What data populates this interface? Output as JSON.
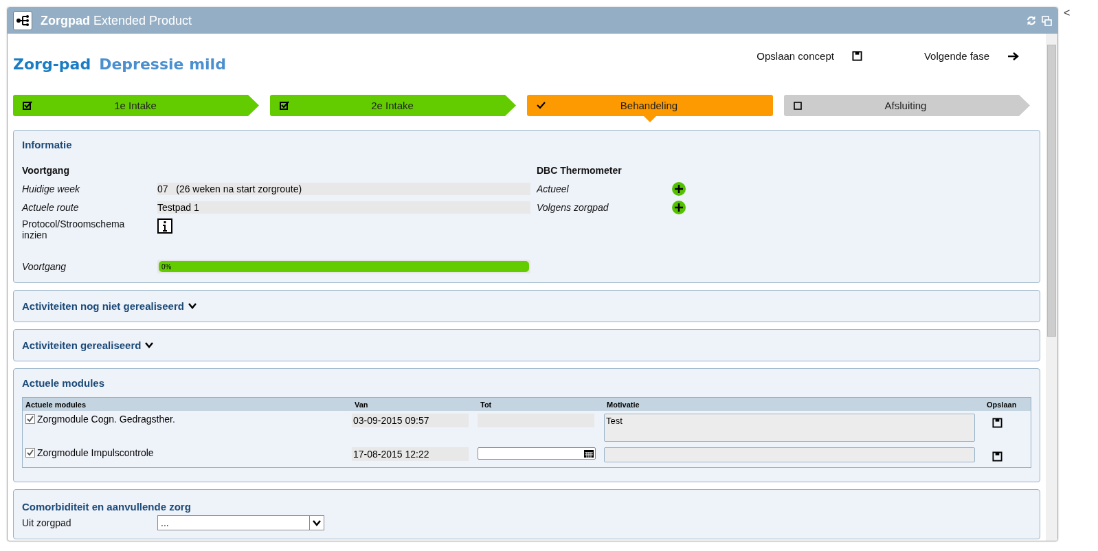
{
  "window": {
    "title_bold": "Zorgpad",
    "title": "Extended Product"
  },
  "header": {
    "label": "Zorg-pad",
    "name": "Depressie mild",
    "actions": [
      {
        "label": "Opslaan concept",
        "kind": "save"
      },
      {
        "label": "Volgende fase",
        "kind": "next"
      }
    ]
  },
  "steps": [
    {
      "label": "1e Intake",
      "kind": "done"
    },
    {
      "label": "2e Intake",
      "kind": "done"
    },
    {
      "label": "Behandeling",
      "kind": "current"
    },
    {
      "label": "Afsluiting",
      "kind": "todo"
    }
  ],
  "informatie": {
    "title": "Informatie",
    "left_heading": "Voortgang",
    "rows": [
      {
        "label": "Huidige week",
        "value": "07   (26 weken na start zorgroute)"
      },
      {
        "label": "Actuele route",
        "value": "Testpad 1"
      }
    ],
    "protocol_label": "Protocol/Stroomschema inzien",
    "progress": {
      "label": "Voortgang",
      "reading": "0%",
      "level": 1
    },
    "right_heading": "DBC Thermometer",
    "right_rows": [
      {
        "label": "Actueel"
      },
      {
        "label": "Volgens zorgpad"
      }
    ]
  },
  "collapsed_sections": [
    {
      "title": "Activiteiten nog niet gerealiseerd",
      "expanded": false
    },
    {
      "title": "Activiteiten gerealiseerd",
      "expanded": false
    }
  ],
  "modules": {
    "title": "Actuele modules",
    "columns": [
      "Actuele modules",
      "Van",
      "Tot",
      "Motivatie",
      "Opslaan"
    ],
    "rows": [
      {
        "checked": true,
        "name": "Zorgmodule Cogn. Gedragsther.",
        "van": "03-09-2015 09:57",
        "tot_editable": false,
        "motivatie": "Test",
        "tall": true
      },
      {
        "checked": true,
        "name": "Zorgmodule Impulscontrole",
        "van": "17-08-2015 12:22",
        "tot_editable": true,
        "motivatie": "",
        "tall": false
      }
    ]
  },
  "comorbiditeit": {
    "title": "Comorbiditeit en aanvullende zorg",
    "label": "Uit zorgpad",
    "value": "..."
  },
  "side_toggle": "<"
}
